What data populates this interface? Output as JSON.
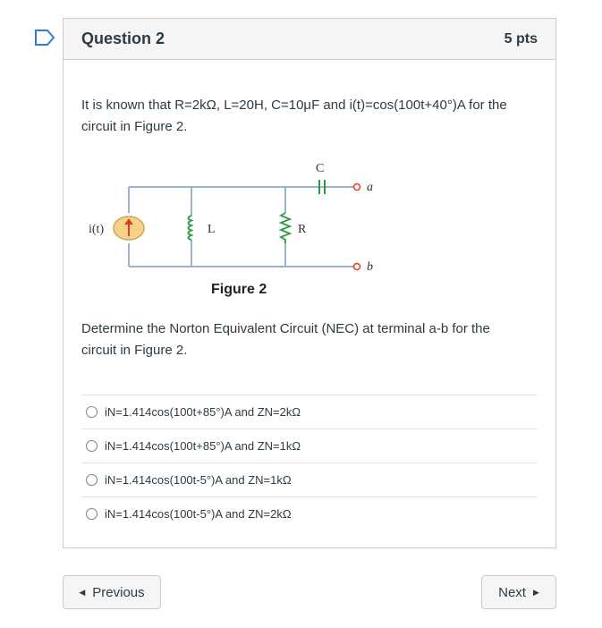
{
  "question": {
    "title": "Question 2",
    "points": "5 pts",
    "text1_line1": "It is known that R=2kΩ, L=20H, C=10μF and i(t)=cos(100t+40°)A for the",
    "text1_line2": "circuit in Figure 2.",
    "text2_line1": "Determine the Norton Equivalent Circuit (NEC) at terminal a-b for the",
    "text2_line2": "circuit in Figure 2."
  },
  "figure": {
    "caption": "Figure 2",
    "source_label": "i(t)",
    "inductor_label": "L",
    "resistor_label": "R",
    "capacitor_label": "C",
    "terminal_a": "a",
    "terminal_b": "b"
  },
  "answers": [
    "iN=1.414cos(100t+85°)A and ZN=2kΩ",
    "iN=1.414cos(100t+85°)A and ZN=1kΩ",
    "iN=1.414cos(100t-5°)A and ZN=1kΩ",
    "iN=1.414cos(100t-5°)A and ZN=2kΩ"
  ],
  "nav": {
    "previous_label": "Previous",
    "next_label": "Next"
  },
  "colors": {
    "flag": "#2d7fd3",
    "wire": "#9ab3d1",
    "source_fill": "#f7d38a",
    "source_arrow": "#e03b24"
  },
  "icons": {
    "flag": "bookmark-flag-icon",
    "previous": "triangle-left-icon",
    "next": "triangle-right-icon"
  }
}
